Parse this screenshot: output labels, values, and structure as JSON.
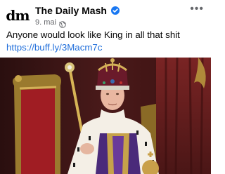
{
  "post": {
    "page_name": "The Daily Mash",
    "avatar_text": "dm",
    "date": "9. mai",
    "separator": "·",
    "text": "Anyone would look like King in all that shit ",
    "link": "https://buff.ly/3Macm7c",
    "more_label": "•••"
  },
  "colors": {
    "verified": "#1877f2",
    "link": "#216fdb",
    "secondary_text": "#65676b"
  },
  "icons": [
    "verified-badge-icon",
    "globe-icon",
    "more-options-icon"
  ]
}
